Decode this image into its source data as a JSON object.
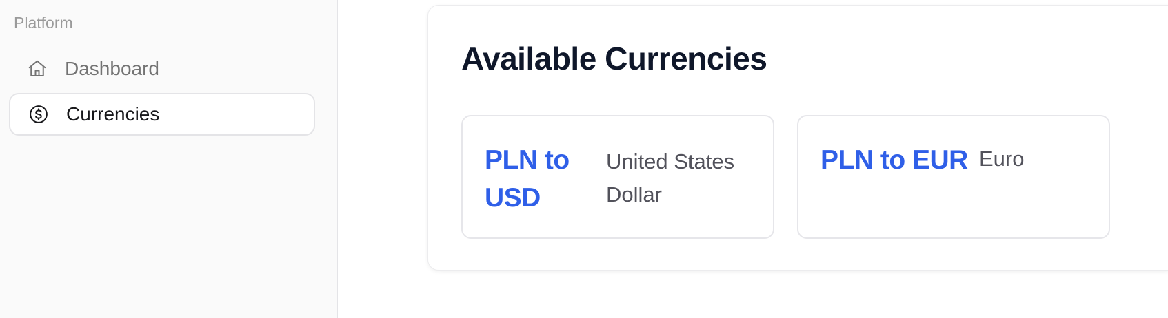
{
  "sidebar": {
    "section_heading": "Platform",
    "items": [
      {
        "label": "Dashboard",
        "icon": "home-icon",
        "active": false
      },
      {
        "label": "Currencies",
        "icon": "dollar-circle-icon",
        "active": true
      }
    ]
  },
  "main": {
    "title": "Available Currencies",
    "currencies": [
      {
        "pair": "PLN to USD",
        "name": "United States Dollar"
      },
      {
        "pair": "PLN to EUR",
        "name": "Euro"
      }
    ]
  },
  "colors": {
    "accent": "#2f5fe8",
    "title": "#0f172a",
    "sidebar_bg": "#fafafa",
    "muted_text": "#737373"
  }
}
